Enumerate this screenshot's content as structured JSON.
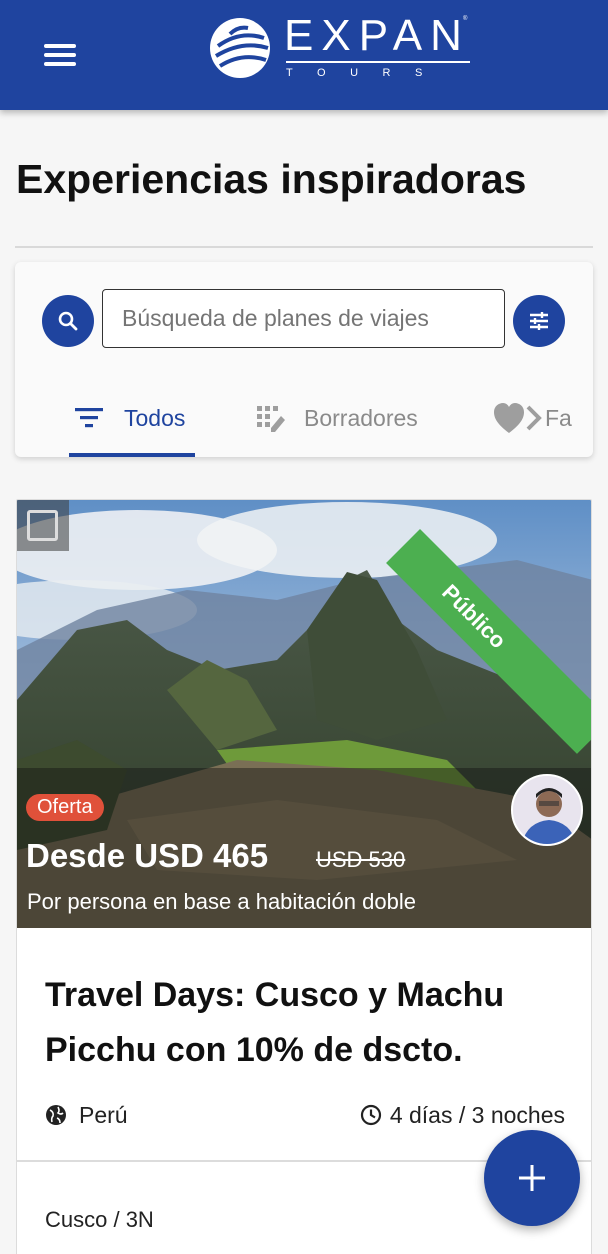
{
  "header": {
    "logo_name": "EXPAN",
    "logo_sub": "TOURS",
    "logo_tm": "®",
    "color": "#1f449f"
  },
  "page": {
    "title": "Experiencias inspiradoras"
  },
  "search": {
    "placeholder": "Búsqueda de planes de viajes",
    "value": "",
    "search_icon": "search-icon",
    "filter_icon": "tune-icon"
  },
  "tabs": [
    {
      "label": "Todos",
      "icon": "filter-list-icon",
      "active": true
    },
    {
      "label": "Borradores",
      "icon": "draft-grid-icon",
      "active": false
    },
    {
      "label": "Fa",
      "icon": "heart-share-icon",
      "active": false
    }
  ],
  "trip": {
    "visibility_label": "Público",
    "badge": "Oferta",
    "price": "Desde USD 465",
    "old_price": "USD 530",
    "price_note": "Por persona en base a habitación doble",
    "title": "Travel Days: Cusco y Machu Picchu con 10% de dscto.",
    "country": "Perú",
    "duration": "4 días / 3 noches",
    "segment": "Cusco / 3N",
    "ribbon_color": "#4caf50",
    "badge_color": "#e0513a"
  },
  "fab": {
    "label": "+"
  }
}
